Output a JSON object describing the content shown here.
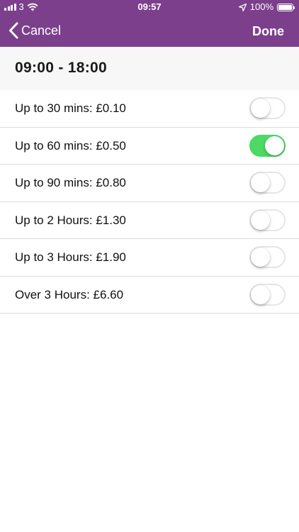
{
  "status_bar": {
    "carrier": "3",
    "time": "09:57",
    "battery_percent": "100%"
  },
  "nav": {
    "cancel_label": "Cancel",
    "done_label": "Done"
  },
  "time_range": "09:00 - 18:00",
  "options": [
    {
      "label": "Up to 30 mins: £0.10",
      "selected": false
    },
    {
      "label": "Up to 60 mins: £0.50",
      "selected": true
    },
    {
      "label": "Up to 90 mins: £0.80",
      "selected": false
    },
    {
      "label": "Up to 2 Hours: £1.30",
      "selected": false
    },
    {
      "label": "Up to 3 Hours: £1.90",
      "selected": false
    },
    {
      "label": "Over 3 Hours: £6.60",
      "selected": false
    }
  ],
  "colors": {
    "header": "#7c3f8c",
    "toggle_on": "#4cd964"
  }
}
